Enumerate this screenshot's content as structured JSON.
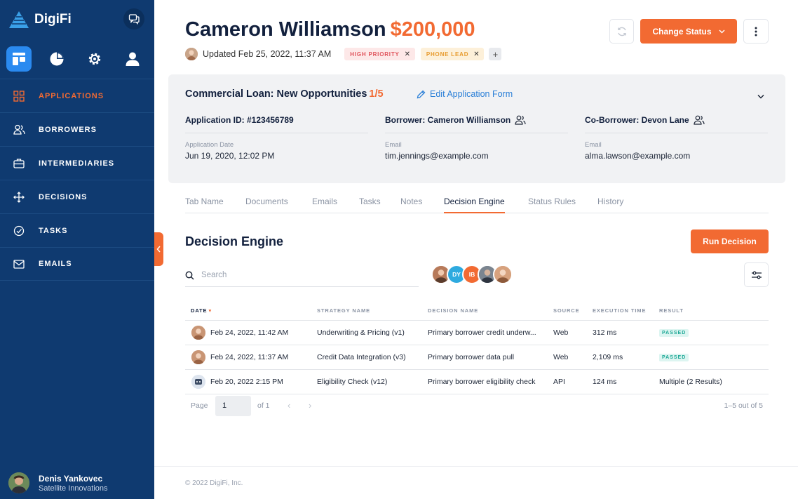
{
  "brand": {
    "name": "DigiFi"
  },
  "sidebar": {
    "top_icons": [
      "applications-board-icon",
      "reports-pie-icon",
      "settings-gear-icon",
      "profile-user-icon"
    ],
    "items": [
      {
        "label": "APPLICATIONS",
        "icon": "grid-icon",
        "active": true
      },
      {
        "label": "BORROWERS",
        "icon": "users-icon"
      },
      {
        "label": "INTERMEDIARIES",
        "icon": "briefcase-icon"
      },
      {
        "label": "DECISIONS",
        "icon": "arrows-icon"
      },
      {
        "label": "TASKS",
        "icon": "check-circle-icon"
      },
      {
        "label": "EMAILS",
        "icon": "envelope-icon"
      }
    ],
    "user": {
      "name": "Denis Yankovec",
      "org": "Satellite Innovations"
    }
  },
  "header": {
    "name": "Cameron Williamson",
    "amount": "$200,000",
    "updated": "Updated Feb 25, 2022, 11:37 AM",
    "tags": [
      "HIGH PRIORITY",
      "PHONE LEAD"
    ],
    "change_status": "Change Status"
  },
  "card": {
    "title": "Commercial Loan: New Opportunities",
    "progress": "1/5",
    "edit_link": "Edit Application Form",
    "application_id": "Application ID: #123456789",
    "borrower": "Borrower: Cameron Williamson",
    "co_borrower": "Co-Borrower: Devon Lane",
    "date_label": "Application Date",
    "date_value": "Jun 19, 2020, 12:02 PM",
    "email_label": "Email",
    "borrower_email": "tim.jennings@example.com",
    "co_borrower_email": "alma.lawson@example.com"
  },
  "tabs": [
    "Tab Name",
    "Documents",
    "Emails",
    "Tasks",
    "Notes",
    "Decision Engine",
    "Status Rules",
    "History"
  ],
  "active_tab": "Decision Engine",
  "decision_engine": {
    "title": "Decision Engine",
    "run_button": "Run Decision",
    "search_placeholder": "Search",
    "avatar_initials": [
      "DY",
      "IB"
    ],
    "columns": [
      "DATE",
      "STRATEGY NAME",
      "DECISION NAME",
      "SOURCE",
      "EXECUTION TIME",
      "RESULT"
    ],
    "rows": [
      {
        "date": "Feb 24, 2022, 11:42 AM",
        "strategy": "Underwriting & Pricing (v1)",
        "decision": "Primary borrower credit underw...",
        "source": "Web",
        "time": "312 ms",
        "result": "PASSED"
      },
      {
        "date": "Feb 24, 2022, 11:37 AM",
        "strategy": "Credit Data Integration (v3)",
        "decision": "Primary borrower data pull",
        "source": "Web",
        "time": "2,109 ms",
        "result": "PASSED"
      },
      {
        "date": "Feb 20, 2022 2:15 PM",
        "strategy": "Eligibility Check (v12)",
        "decision": "Primary borrower eligibility check",
        "source": "API",
        "time": "124 ms",
        "result": "Multiple (2 Results)"
      }
    ],
    "pager": {
      "page_label": "Page",
      "page_value": "1",
      "of_label": "of 1",
      "range": "1–5 out of 5"
    }
  },
  "footer": {
    "text": "© 2022 DigiFi, Inc."
  },
  "colors": {
    "sidebar": "#0f3a70",
    "accent": "#f26a32",
    "active_icon": "#2a8af0",
    "passed": "#1da896"
  }
}
